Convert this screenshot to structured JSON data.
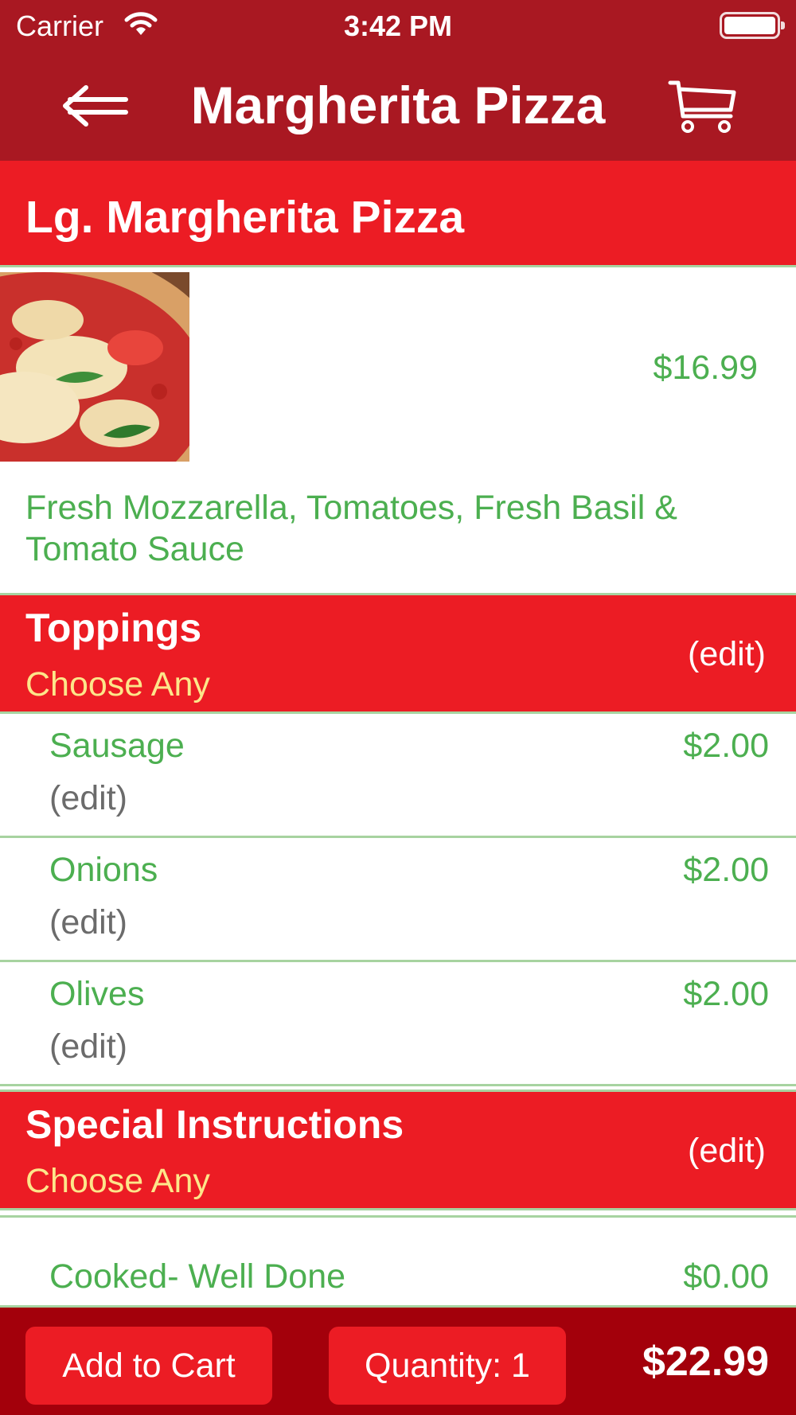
{
  "status_bar": {
    "carrier": "Carrier",
    "time": "3:42 PM"
  },
  "nav": {
    "title": "Margherita Pizza",
    "back_icon": "back-arrow-icon",
    "cart_icon": "cart-icon"
  },
  "item": {
    "name": "Lg. Margherita Pizza",
    "price": "$16.99",
    "description": "Fresh Mozzarella, Tomatoes, Fresh Basil & Tomato Sauce"
  },
  "toppings": {
    "title": "Toppings",
    "subtitle": "Choose Any",
    "edit_label": "(edit)",
    "items": [
      {
        "name": "Sausage",
        "price": "$2.00",
        "edit": "(edit)"
      },
      {
        "name": "Onions",
        "price": "$2.00",
        "edit": "(edit)"
      },
      {
        "name": "Olives",
        "price": "$2.00",
        "edit": "(edit)"
      }
    ]
  },
  "special_instructions": {
    "title": "Special Instructions",
    "subtitle": "Choose Any",
    "edit_label": "(edit)",
    "items": [
      {
        "name": "Cooked- Well Done",
        "price": "$0.00"
      }
    ]
  },
  "footer": {
    "add_to_cart": "Add to Cart",
    "quantity": "Quantity: 1",
    "total": "$22.99"
  },
  "colors": {
    "nav_red": "#a91822",
    "accent_red": "#ec1c24",
    "footer_red": "#a3000b",
    "price_green": "#4caf50",
    "subtitle_yellow": "#fde68a",
    "divider_green": "#a7d3a0"
  }
}
